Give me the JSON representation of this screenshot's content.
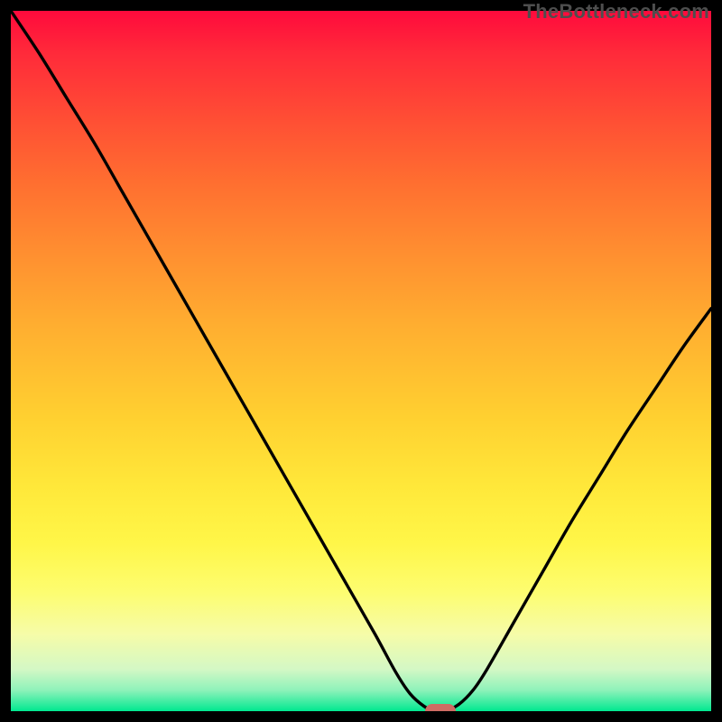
{
  "watermark": "TheBottleneck.com",
  "chart_data": {
    "type": "line",
    "title": "",
    "xlabel": "",
    "ylabel": "",
    "xlim": [
      0,
      100
    ],
    "ylim": [
      0,
      100
    ],
    "grid": false,
    "series": [
      {
        "name": "bottleneck-curve",
        "x": [
          0,
          4,
          8,
          12,
          16,
          20,
          24,
          28,
          32,
          36,
          40,
          44,
          48,
          52,
          55,
          57,
          59,
          60.5,
          62,
          64,
          66,
          68,
          72,
          76,
          80,
          84,
          88,
          92,
          96,
          100
        ],
        "values": [
          100,
          94,
          87.5,
          81,
          74,
          67,
          60,
          53,
          46,
          39,
          32,
          25,
          18,
          11,
          5.5,
          2.5,
          0.7,
          0,
          0,
          1,
          3,
          6,
          13,
          20,
          27,
          33.5,
          40,
          46,
          52,
          57.5
        ]
      }
    ],
    "marker": {
      "x": 61.3,
      "y": 0,
      "label": ""
    },
    "colors": {
      "gradient_top": "#ff0a3c",
      "gradient_mid": "#ffe83a",
      "gradient_bottom": "#00e890",
      "curve": "#000000",
      "marker": "#cf6b63",
      "frame": "#000000"
    }
  }
}
